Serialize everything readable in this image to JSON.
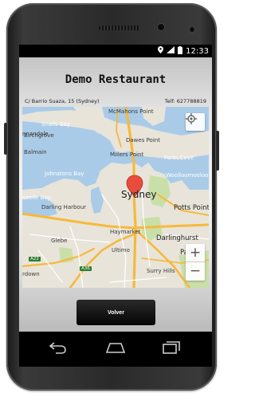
{
  "status_bar": {
    "time": "12:33"
  },
  "header": {
    "title": "Demo Restaurant"
  },
  "info": {
    "address": "C/ Barrio Suaza, 15 (Sydney)",
    "phone": "Telf: 627788819"
  },
  "map": {
    "labels": {
      "mcmahons_point": "McMahons Point",
      "snails_bay": "Snails Bay",
      "birchgrove": "Birchgrove",
      "dawes_point": "Dawes Point",
      "balmain": "Balmain",
      "millers_point": "Millers Point",
      "farm_cove": "Farm Cove",
      "johnstons_bay": "Johnstons Bay",
      "woolloomooloo_bay": "Woolloomooloo Bay",
      "sydney": "Sydney",
      "rozelle_bay": "ozelle Bay",
      "darling_harbour": "Darling Harbour",
      "potts_point": "Potts Point",
      "haymarket": "Haymarket",
      "darlinghurst": "Darlinghurst",
      "glebe": "Glebe",
      "ultimo": "Ultimo",
      "paddington": "Paddin",
      "surry_hills": "Surry Hills",
      "camperdown": "rdown",
      "annandale": "nnandale",
      "a22": "A22",
      "a36": "A36"
    },
    "zoom_in": "+",
    "zoom_out": "−"
  },
  "actions": {
    "back_label": "Volver"
  },
  "colors": {
    "water": "#a9cbe8",
    "land": "#e8e4da",
    "road": "#f6b93b",
    "park": "#c9dfa8",
    "marker": "#e84c3d"
  }
}
